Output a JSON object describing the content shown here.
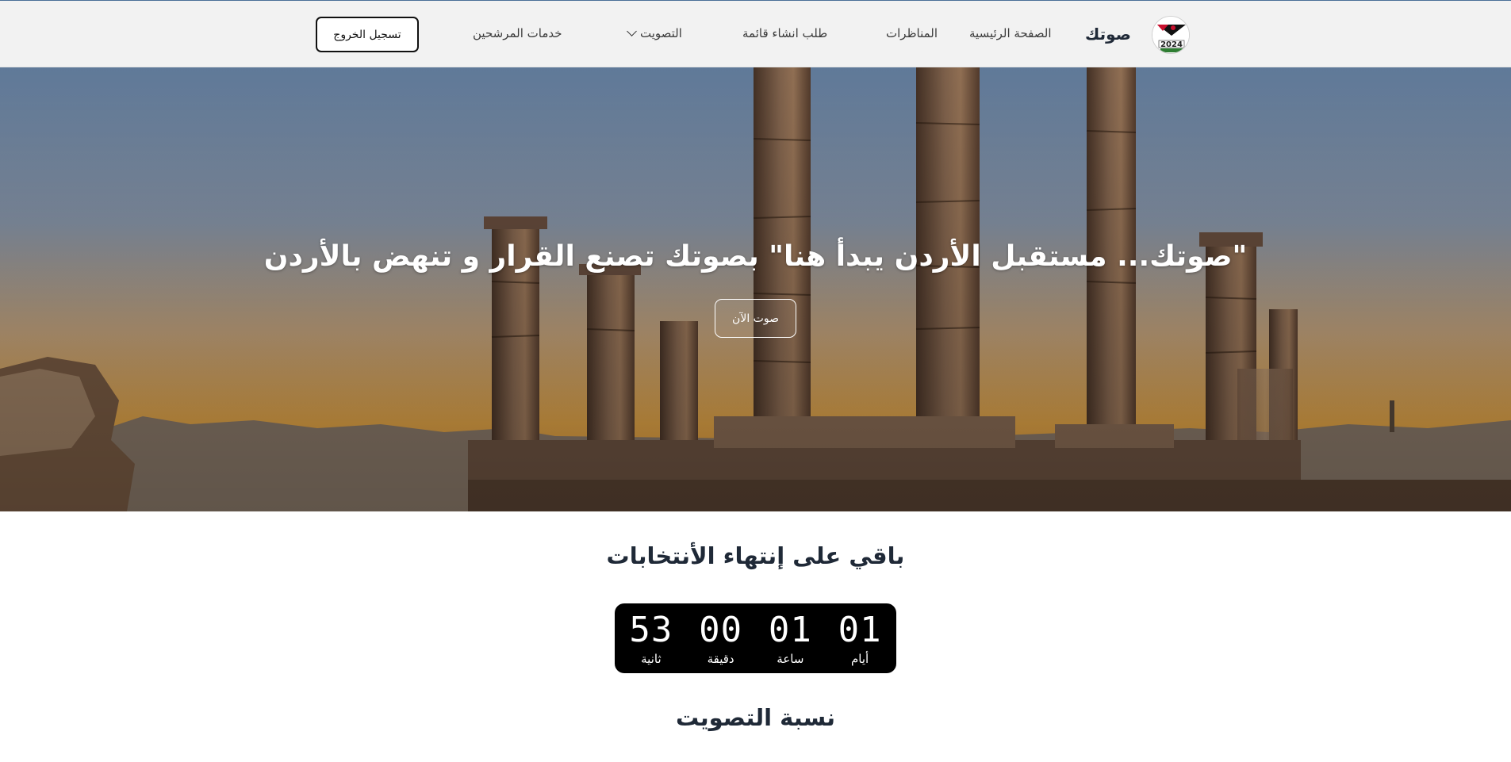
{
  "nav": {
    "brand": "صوتك",
    "logo_icon": "jordan-2024-election-logo",
    "links": {
      "home": "الصفحة الرئيسية",
      "debates": "المناظرات",
      "create_list": "طلب انشاء قائمة",
      "voting": "التصويت",
      "candidate_services": "خدمات المرشحين"
    },
    "logout": "تسجيل الخروج"
  },
  "hero": {
    "title": "\"صوتك... مستقبل الأردن يبدأ هنا\" بصوتك تصنع القرار و تنهض بالأردن",
    "cta": "صوت الآن"
  },
  "countdown": {
    "title": "باقي على إنتهاء الأنتخابات",
    "days": {
      "value": "01",
      "label": "أيام"
    },
    "hours": {
      "value": "01",
      "label": "ساعة"
    },
    "minutes": {
      "value": "00",
      "label": "دقيقة"
    },
    "seconds": {
      "value": "53",
      "label": "ثانية"
    }
  },
  "turnout": {
    "title": "نسبة التصويت"
  },
  "colors": {
    "navbar_bg": "#f2f2f2",
    "countdown_bg": "#000000",
    "heading_text": "#1f2937"
  }
}
